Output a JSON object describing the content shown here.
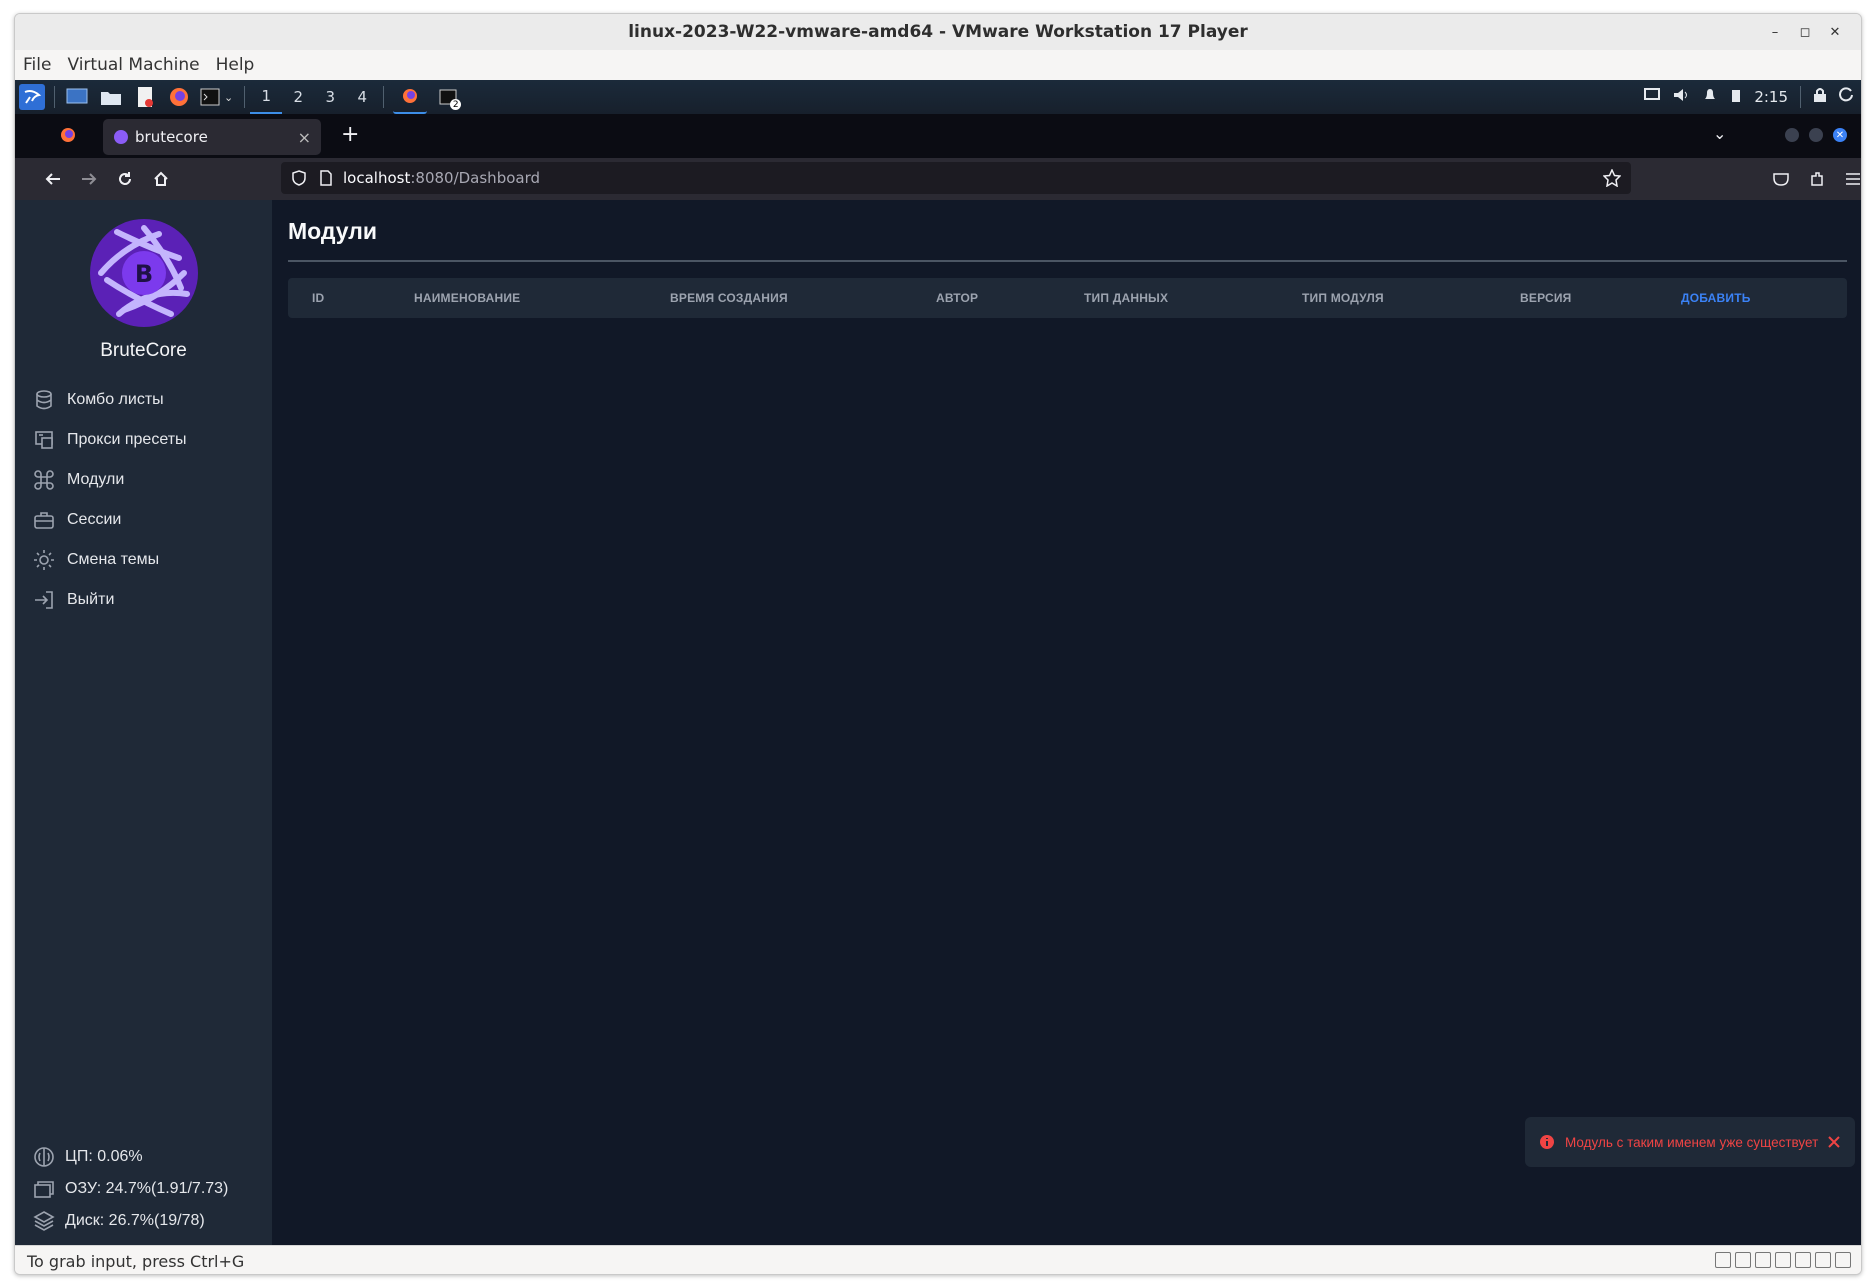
{
  "window": {
    "title": "linux-2023-W22-vmware-amd64 - VMware Workstation 17 Player",
    "menu": [
      "File",
      "Virtual Machine",
      "Help"
    ],
    "status_hint": "To grab input, press Ctrl+G"
  },
  "panel": {
    "workspaces": [
      "1",
      "2",
      "3",
      "4"
    ],
    "clock": "2:15",
    "terminal_badge": "2"
  },
  "browser": {
    "tab_title": "brutecore",
    "tab_close": "×",
    "new_tab": "+",
    "url_host": "localhost",
    "url_path": ":8080/Dashboard"
  },
  "sidebar": {
    "brand": "BruteCore",
    "logo_letter": "B",
    "items": [
      {
        "label": "Комбо листы",
        "icon": "database-icon"
      },
      {
        "label": "Прокси пресеты",
        "icon": "proxy-icon"
      },
      {
        "label": "Модули",
        "icon": "command-icon"
      },
      {
        "label": "Сессии",
        "icon": "briefcase-icon"
      },
      {
        "label": "Смена темы",
        "icon": "sun-icon"
      },
      {
        "label": "Выйти",
        "icon": "logout-icon"
      }
    ],
    "stats": {
      "cpu": "ЦП: 0.06%",
      "ram": "ОЗУ: 24.7%(1.91/7.73)",
      "disk": "Диск: 26.7%(19/78)"
    }
  },
  "main": {
    "title": "Модули",
    "columns": [
      "ID",
      "НАИМЕНОВАНИЕ",
      "ВРЕМЯ СОЗДАНИЯ",
      "АВТОР",
      "ТИП ДАННЫХ",
      "ТИП МОДУЛЯ",
      "ВЕРСИЯ"
    ],
    "add_label": "ДОБАВИТЬ"
  },
  "toast": {
    "message": "Модуль с таким именем уже существует",
    "color": "#ef4444"
  }
}
